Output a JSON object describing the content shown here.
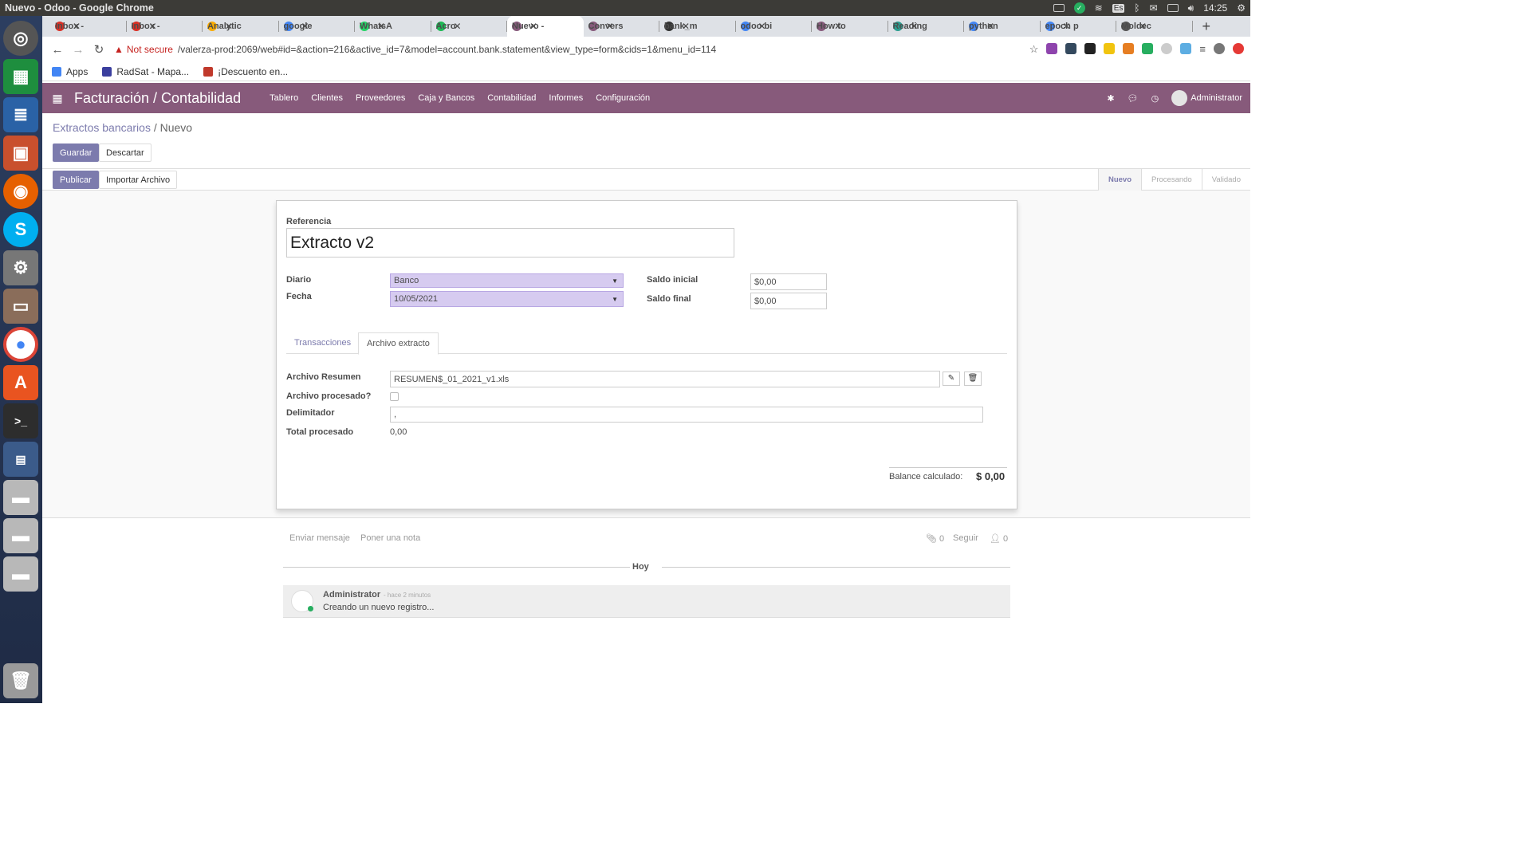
{
  "os": {
    "window_title": "Nuevo - Odoo - Google Chrome",
    "input_lang": "Es",
    "time": "14:25"
  },
  "browser": {
    "tabs": [
      {
        "label": "Inbox -",
        "icon": "gmail-icon",
        "color": "#d93025"
      },
      {
        "label": "Inbox -",
        "icon": "gmail-icon",
        "color": "#d93025"
      },
      {
        "label": "Analytic",
        "icon": "analytics-icon",
        "color": "#f9ab00"
      },
      {
        "label": "google",
        "icon": "google-icon",
        "color": "#4285f4"
      },
      {
        "label": "WhatsA",
        "icon": "whatsapp-icon",
        "color": "#25d366"
      },
      {
        "label": "Acro",
        "icon": "spotify-icon",
        "color": "#1db954"
      },
      {
        "label": "Nuevo -",
        "icon": "odoo-icon",
        "color": "#875a7b",
        "active": true
      },
      {
        "label": "Convers",
        "icon": "odoo-icon",
        "color": "#875a7b"
      },
      {
        "label": "bank_m",
        "icon": "github-icon",
        "color": "#333333"
      },
      {
        "label": "odoo bi",
        "icon": "google-icon",
        "color": "#4285f4"
      },
      {
        "label": "How to",
        "icon": "odoo-icon",
        "color": "#875a7b"
      },
      {
        "label": "Reading",
        "icon": "link-icon",
        "color": "#2a9d8f"
      },
      {
        "label": "python",
        "icon": "google-icon",
        "color": "#4285f4"
      },
      {
        "label": "epoch p",
        "icon": "google-icon",
        "color": "#4285f4"
      },
      {
        "label": "Moldec",
        "icon": "page-icon",
        "color": "#555555"
      }
    ],
    "security_warning": "Not secure",
    "url": "/valerza-prod:2069/web#id=&action=216&active_id=7&model=account.bank.statement&view_type=form&cids=1&menu_id=114",
    "bookmarks": [
      {
        "label": "Apps",
        "icon": "apps-grid-icon"
      },
      {
        "label": "RadSat - Mapa...",
        "icon": "globe-icon"
      },
      {
        "label": "¡Descuento en...",
        "icon": "crown-icon"
      }
    ]
  },
  "odoo": {
    "app_title": "Facturación / Contabilidad",
    "menu": [
      "Tablero",
      "Clientes",
      "Proveedores",
      "Caja y Bancos",
      "Contabilidad",
      "Informes",
      "Configuración"
    ],
    "user": "Administrator"
  },
  "breadcrumb": {
    "parent": "Extractos bancarios",
    "separator": "/",
    "current": "Nuevo"
  },
  "buttons": {
    "save": "Guardar",
    "discard": "Descartar",
    "publish": "Publicar",
    "import": "Importar Archivo"
  },
  "stages": [
    {
      "label": "Nuevo",
      "current": true
    },
    {
      "label": "Procesando",
      "current": false
    },
    {
      "label": "Validado",
      "current": false
    }
  ],
  "form": {
    "reference_label": "Referencia",
    "reference_value": "Extracto v2",
    "journal_label": "Diario",
    "journal_value": "Banco",
    "date_label": "Fecha",
    "date_value": "10/05/2021",
    "start_balance_label": "Saldo inicial",
    "start_balance_value": "$0,00",
    "end_balance_label": "Saldo final",
    "end_balance_value": "$0,00",
    "tabs": [
      "Transacciones",
      "Archivo extracto"
    ],
    "file_label": "Archivo Resumen",
    "file_value": "RESUMEN$_01_2021_v1.xls",
    "processed_label": "Archivo procesado?",
    "delimiter_label": "Delimitador",
    "delimiter_value": ",",
    "total_label": "Total procesado",
    "total_value": "0,00",
    "balance_label": "Balance calculado:",
    "balance_value": "$ 0,00"
  },
  "chatter": {
    "send_message": "Enviar mensaje",
    "log_note": "Poner una nota",
    "attachments_count": "0",
    "follow": "Seguir",
    "followers_count": "0",
    "date_separator": "Hoy",
    "messages": [
      {
        "author": "Administrator",
        "date": "- hace 2 minutos",
        "body": "Creando un nuevo registro..."
      }
    ]
  },
  "colors": {
    "odoo_primary": "#875a7b",
    "button_primary": "#7c7bad",
    "select_bg": "#d6cbf0"
  }
}
